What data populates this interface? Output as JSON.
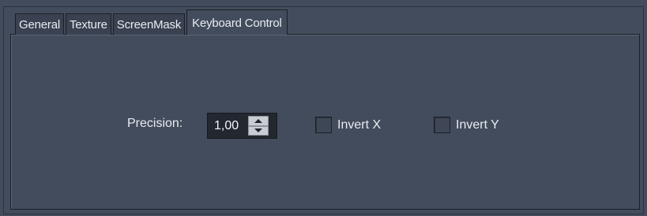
{
  "tabs": [
    {
      "label": "General",
      "active": false
    },
    {
      "label": "Texture",
      "active": false
    },
    {
      "label": "ScreenMask",
      "active": false
    },
    {
      "label": "Keyboard Control",
      "active": true
    }
  ],
  "precision": {
    "label": "Precision:",
    "value": "1,00"
  },
  "invert_x": {
    "label": "Invert X",
    "checked": false
  },
  "invert_y": {
    "label": "Invert Y",
    "checked": false
  },
  "colors": {
    "background": "#434c5c",
    "inactive_tab": "#3a4150",
    "spin_field": "#232830",
    "spin_button": "#c9cdd3"
  }
}
